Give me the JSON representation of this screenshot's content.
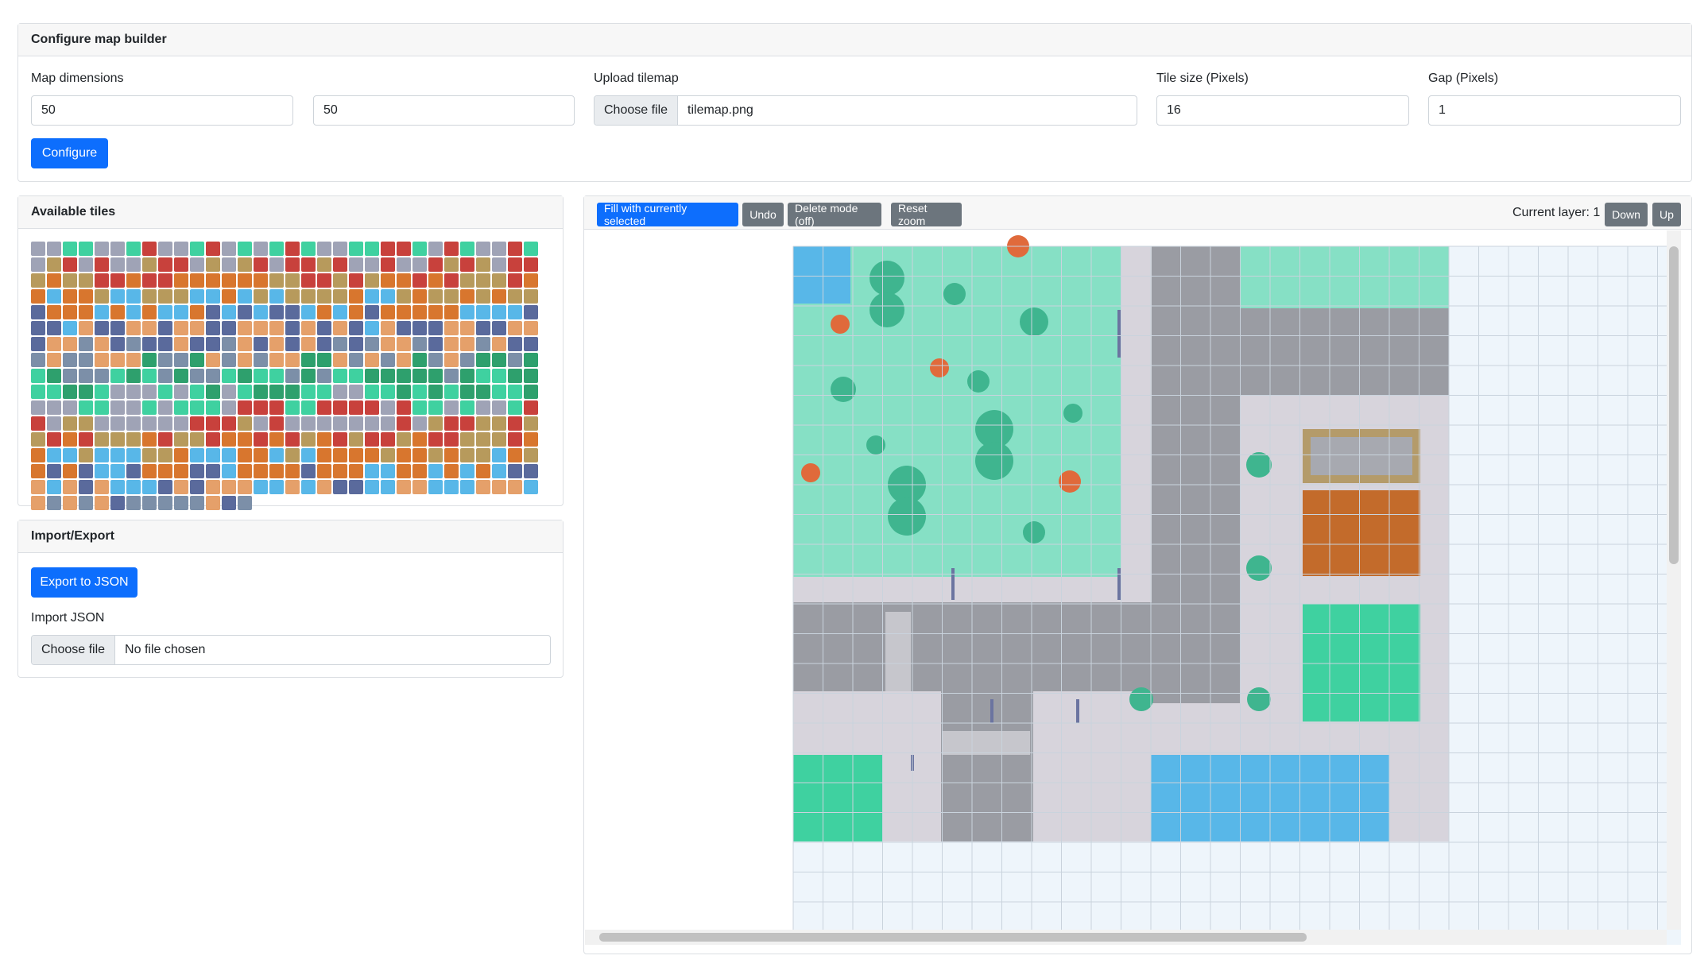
{
  "config": {
    "title": "Configure map builder",
    "map_dimensions_label": "Map dimensions",
    "width_value": "50",
    "height_value": "50",
    "upload_label": "Upload tilemap",
    "upload_button": "Choose file",
    "upload_filename": "tilemap.png",
    "tile_size_label": "Tile size (Pixels)",
    "tile_size_value": "16",
    "gap_label": "Gap (Pixels)",
    "gap_value": "1",
    "configure_button": "Configure"
  },
  "tiles_panel": {
    "title": "Available tiles"
  },
  "import_export": {
    "title": "Import/Export",
    "export_button": "Export to JSON",
    "import_label": "Import JSON",
    "import_button": "Choose file",
    "import_filename": "No file chosen"
  },
  "toolbar": {
    "fill_button": "Fill with currently selected",
    "undo_button": "Undo",
    "delete_mode_button": "Delete mode (off)",
    "reset_zoom_button": "Reset zoom",
    "current_layer_text": "Current layer: 1",
    "down_button": "Down",
    "up_button": "Up"
  },
  "colors": {
    "primary": "#0d6efd",
    "secondary": "#6c757d",
    "grass": "#86e0c5",
    "water": "#58b7e8",
    "road": "#9a9ca3",
    "sidewalk": "#d7d4dc",
    "grid_bg": "#eef5fb"
  }
}
